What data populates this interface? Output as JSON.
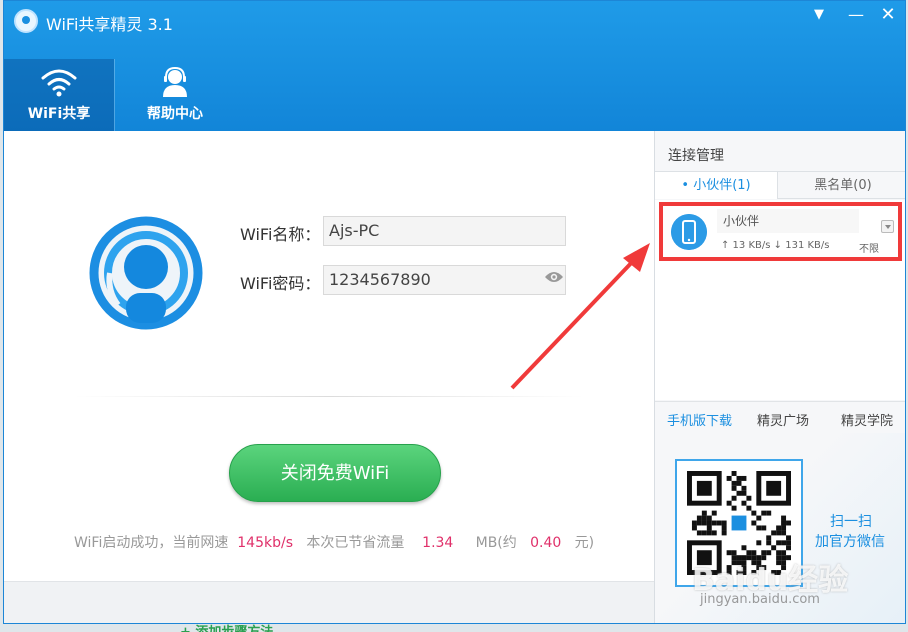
{
  "window": {
    "title": "WiFi共享精灵 3.1",
    "menu_icon": "triangle-menu-icon",
    "min_icon": "minimize-icon",
    "close_icon": "close-icon"
  },
  "nav": {
    "tabs": [
      {
        "label": "WiFi共享",
        "icon": "wifi-icon",
        "active": true
      },
      {
        "label": "帮助中心",
        "icon": "support-agent-icon",
        "active": false
      }
    ]
  },
  "main": {
    "name_label": "WiFi名称：",
    "name_value": "Ajs-PC",
    "password_label": "WiFi密码：",
    "password_value": "1234567890",
    "close_button": "关闭免费WiFi",
    "status": {
      "prefix": "WiFi启动成功，当前网速",
      "speed": "145kb/s",
      "saved_label": "本次已节省流量",
      "saved_value": "1.34",
      "unit": "MB(约",
      "money": "0.40",
      "suffix": "元)"
    }
  },
  "side": {
    "title": "连接管理",
    "tab_friends": "• 小伙伴(1)",
    "tab_blacklist": "黑名单(0)",
    "devices": [
      {
        "name": "小伙伴",
        "up": "↑ 13 KB/s",
        "down": "↓ 131 KB/s",
        "limit": "不限"
      }
    ],
    "links": [
      "手机版下载",
      "精灵广场",
      "精灵学院"
    ],
    "qr_caption_1": "扫一扫",
    "qr_caption_2": "加官方微信"
  },
  "watermark": {
    "text": "Baidu经验",
    "url": "jingyan.baidu.com"
  },
  "background_text": "+ 添加步骤方法",
  "colors": {
    "header_blue": "#1285d8",
    "accent_blue": "#1b8fe0",
    "highlight_pink": "#e0306a",
    "button_green": "#2aae52",
    "annotation_red": "#f03a3a"
  }
}
